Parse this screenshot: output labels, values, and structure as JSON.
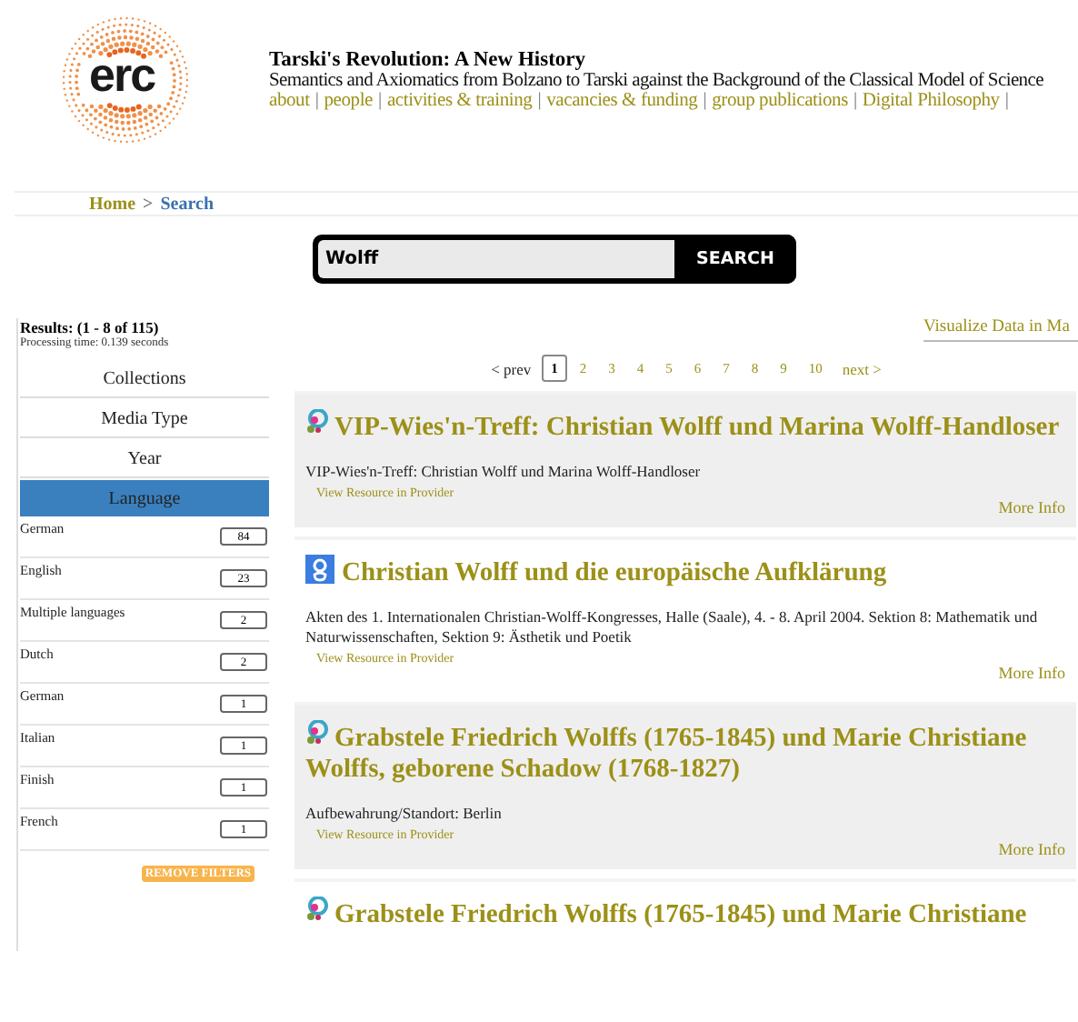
{
  "header": {
    "logo_text": "erc",
    "title": "Tarski's Revolution: A New History",
    "subtitle": "Semantics and Axiomatics from Bolzano to Tarski against the Background of the Classical Model of Science",
    "nav_separator": "|",
    "nav": [
      "about",
      "people",
      "activities & training",
      "vacancies & funding",
      "group publications",
      "Digital Philosophy"
    ]
  },
  "breadcrumb": {
    "home": "Home",
    "separator": ">",
    "current": "Search"
  },
  "search": {
    "value": "Wolff",
    "button": "SEARCH"
  },
  "sidebar": {
    "results": "Results: (1 - 8 of 115)",
    "processing": "Processing time: 0.139 seconds",
    "facets": [
      {
        "label": "Collections",
        "selected": false
      },
      {
        "label": "Media Type",
        "selected": false
      },
      {
        "label": "Year",
        "selected": false
      },
      {
        "label": "Language",
        "selected": true
      }
    ],
    "languages": [
      {
        "name": "German",
        "count": "84"
      },
      {
        "name": "English",
        "count": "23"
      },
      {
        "name": "Multiple languages",
        "count": "2"
      },
      {
        "name": "Dutch",
        "count": "2"
      },
      {
        "name": "German",
        "count": "1"
      },
      {
        "name": "Italian",
        "count": "1"
      },
      {
        "name": "Finish",
        "count": "1"
      },
      {
        "name": "French",
        "count": "1"
      }
    ],
    "remove_button": "REMOVE FILTERS"
  },
  "visualize_link": "Visualize Data in Ma",
  "pagination": {
    "prev": "< prev",
    "next": "next >",
    "pages": [
      {
        "label": "1",
        "selected": true
      },
      {
        "label": "2",
        "selected": false
      },
      {
        "label": "3",
        "selected": false
      },
      {
        "label": "4",
        "selected": false
      },
      {
        "label": "5",
        "selected": false
      },
      {
        "label": "6",
        "selected": false
      },
      {
        "label": "7",
        "selected": false
      },
      {
        "label": "8",
        "selected": false
      },
      {
        "label": "9",
        "selected": false
      },
      {
        "label": "10",
        "selected": false
      }
    ]
  },
  "results": [
    {
      "kind": "europeana",
      "title": "VIP-Wies'n-Treff: Christian Wolff und Marina Wolff-Handloser",
      "description": "VIP-Wies'n-Treff: Christian Wolff und Marina Wolff-Handloser",
      "view_link": "View Resource in Provider",
      "more": "More Info"
    },
    {
      "kind": "google",
      "title": "Christian Wolff und die europäische Aufklärung",
      "description": "Akten des 1. Internationalen Christian-Wolff-Kongresses, Halle (Saale), 4. - 8. April 2004. Sektion 8: Mathematik und Naturwissenschaften, Sektion 9: Ästhetik und Poetik",
      "view_link": "View Resource in Provider",
      "more": "More Info"
    },
    {
      "kind": "europeana",
      "title": "Grabstele Friedrich Wolffs (1765-1845) und Marie Christiane Wolffs, geborene Schadow (1768-1827)",
      "description": "Aufbewahrung/Standort: Berlin",
      "view_link": "View Resource in Provider",
      "more": "More Info"
    },
    {
      "kind": "europeana",
      "title": "Grabstele Friedrich Wolffs (1765-1845) und Marie Christiane"
    }
  ]
}
